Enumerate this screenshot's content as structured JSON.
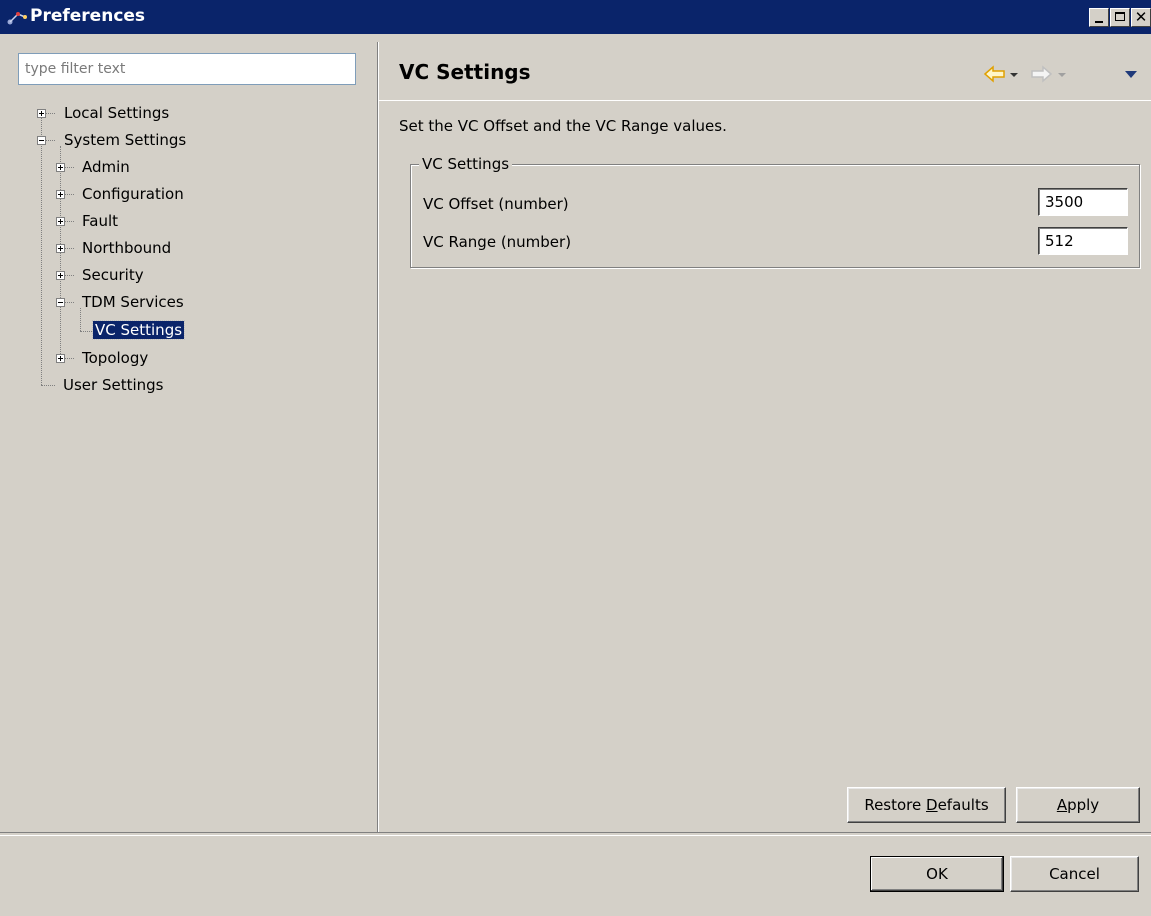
{
  "window": {
    "title": "Preferences"
  },
  "filter": {
    "placeholder": "type filter text"
  },
  "tree": {
    "local_settings": "Local Settings",
    "system_settings": "System Settings",
    "admin": "Admin",
    "configuration": "Configuration",
    "fault": "Fault",
    "northbound": "Northbound",
    "security": "Security",
    "tdm_services": "TDM Services",
    "vc_settings": "VC Settings",
    "topology": "Topology",
    "user_settings": "User Settings"
  },
  "page": {
    "title": "VC Settings",
    "description": "Set the VC Offset and the VC Range values.",
    "group_label": "VC Settings",
    "fields": [
      {
        "label": "VC Offset (number)",
        "value": "3500"
      },
      {
        "label": "VC Range (number)",
        "value": "512"
      }
    ]
  },
  "buttons": {
    "restore_defaults_pre": "Restore ",
    "restore_defaults_mn": "D",
    "restore_defaults_post": "efaults",
    "apply_mn": "A",
    "apply_post": "pply",
    "ok": "OK",
    "cancel": "Cancel"
  },
  "icons": {
    "back": "back-arrow-icon",
    "forward": "forward-arrow-icon",
    "menu": "view-menu-icon"
  },
  "colors": {
    "titlebar": "#0a246a",
    "selection": "#0a246a",
    "back_arrow": "#f0b400",
    "face": "#d4d0c8"
  }
}
